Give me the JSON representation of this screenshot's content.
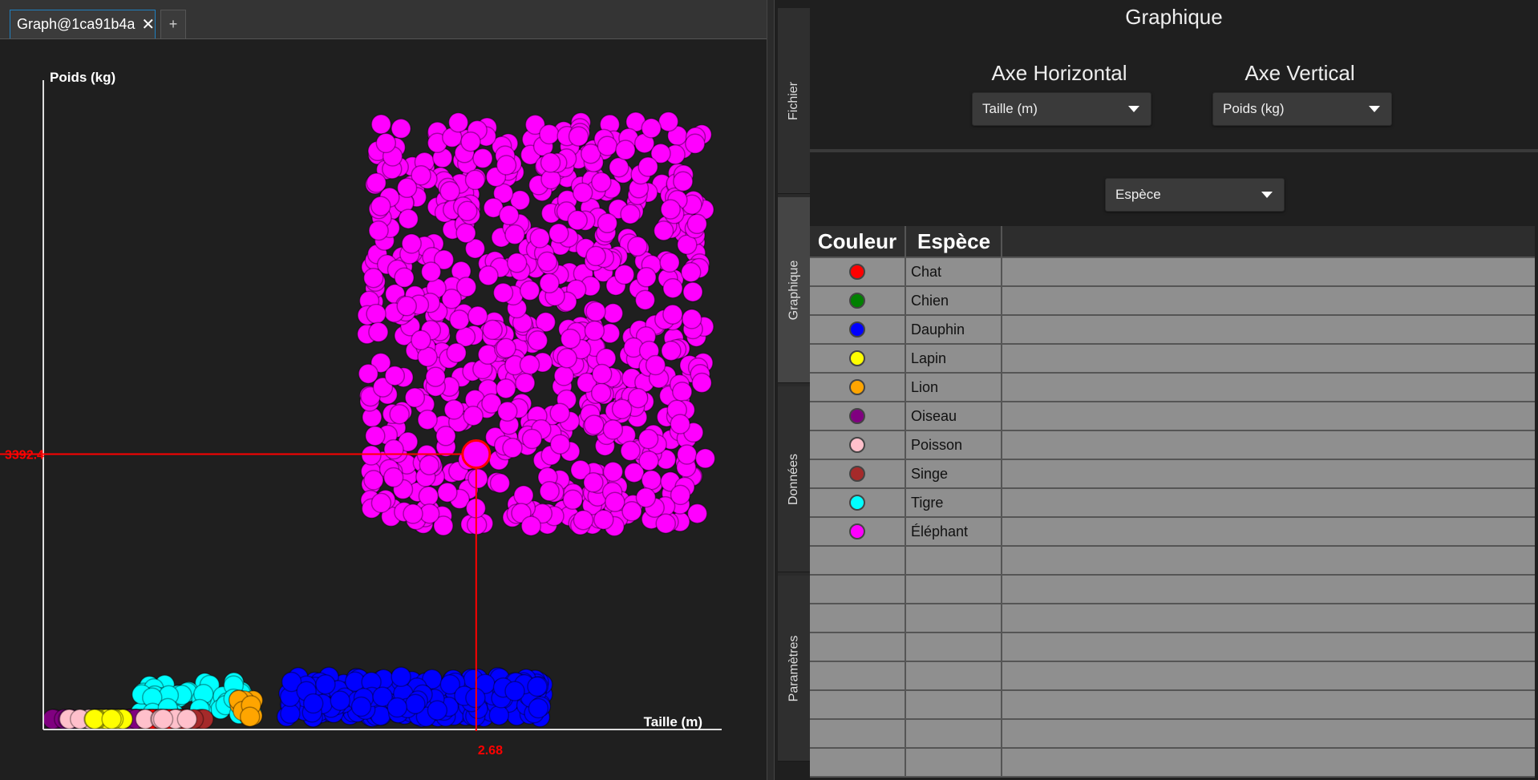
{
  "tabs": {
    "active_label": "Graph@1ca91b4a",
    "close_glyph": "✕",
    "add_glyph": "+"
  },
  "side_tabs": [
    "Fichier",
    "Graphique",
    "Données",
    "Paramètres"
  ],
  "panel": {
    "title": "Graphique",
    "h_axis_label": "Axe Horizontal",
    "h_axis_value": "Taille (m)",
    "v_axis_label": "Axe Vertical",
    "v_axis_value": "Poids (kg)",
    "group_value": "Espèce"
  },
  "legend": {
    "headers": [
      "Couleur",
      "Espèce"
    ],
    "rows": [
      {
        "color": "#ff0000",
        "name": "Chat"
      },
      {
        "color": "#008000",
        "name": "Chien"
      },
      {
        "color": "#0000ff",
        "name": "Dauphin"
      },
      {
        "color": "#ffff00",
        "name": "Lapin"
      },
      {
        "color": "#ffa500",
        "name": "Lion"
      },
      {
        "color": "#800080",
        "name": "Oiseau"
      },
      {
        "color": "#ffc0cb",
        "name": "Poisson"
      },
      {
        "color": "#a52a2a",
        "name": "Singe"
      },
      {
        "color": "#00ffff",
        "name": "Tigre"
      },
      {
        "color": "#ff00ff",
        "name": "Éléphant"
      }
    ],
    "empty_rows": 8
  },
  "chart_data": {
    "type": "scatter",
    "xlabel": "Taille (m)",
    "ylabel": "Poids (kg)",
    "xlim": [
      0,
      4.2
    ],
    "ylim": [
      0,
      8000
    ],
    "crosshair": {
      "x": 2.68,
      "y": 3392.4,
      "x_label": "2.68",
      "y_label": "3392.4"
    },
    "series": [
      {
        "name": "Chat",
        "color": "#ff0000",
        "x_range": [
          0.4,
          0.9
        ],
        "y_range": [
          3,
          8
        ],
        "n": 25
      },
      {
        "name": "Chien",
        "color": "#008000",
        "x_range": [
          0.3,
          1.0
        ],
        "y_range": [
          5,
          60
        ],
        "n": 25
      },
      {
        "name": "Dauphin",
        "color": "#0000ff",
        "x_range": [
          1.5,
          3.1
        ],
        "y_range": [
          150,
          650
        ],
        "n": 260
      },
      {
        "name": "Lapin",
        "color": "#ffff00",
        "x_range": [
          0.3,
          0.5
        ],
        "y_range": [
          1,
          3
        ],
        "n": 15
      },
      {
        "name": "Lion",
        "color": "#ffa500",
        "x_range": [
          1.2,
          1.3
        ],
        "y_range": [
          150,
          400
        ],
        "n": 15
      },
      {
        "name": "Oiseau",
        "color": "#800080",
        "x_range": [
          0.05,
          0.6
        ],
        "y_range": [
          0.5,
          2
        ],
        "n": 15
      },
      {
        "name": "Poisson",
        "color": "#ffc0cb",
        "x_range": [
          0.1,
          0.9
        ],
        "y_range": [
          1,
          5
        ],
        "n": 15
      },
      {
        "name": "Singe",
        "color": "#a52a2a",
        "x_range": [
          0.5,
          1.0
        ],
        "y_range": [
          10,
          60
        ],
        "n": 25
      },
      {
        "name": "Tigre",
        "color": "#00ffff",
        "x_range": [
          0.6,
          1.3
        ],
        "y_range": [
          150,
          600
        ],
        "n": 50
      },
      {
        "name": "Éléphant",
        "color": "#ff00ff",
        "x_range": [
          2.0,
          4.1
        ],
        "y_range": [
          2500,
          7500
        ],
        "n": 700
      }
    ]
  }
}
